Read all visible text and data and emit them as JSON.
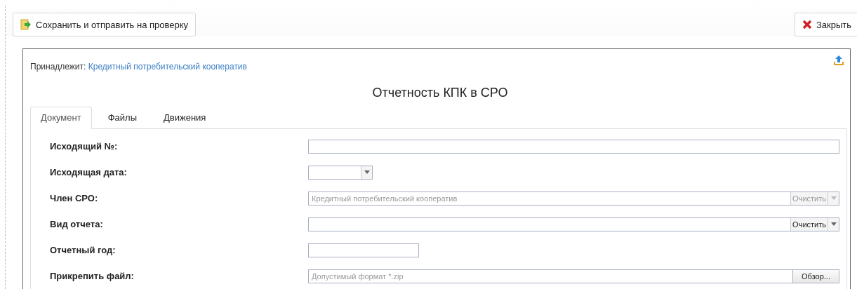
{
  "toolbar": {
    "save_button": "Сохранить и отправить на проверку",
    "close_button": "Закрыть"
  },
  "panel": {
    "owner_label": "Принадлежит:",
    "owner_link": "Кредитный потребительский кооператив",
    "title": "Отчетность КПК в СРО",
    "tabs": [
      {
        "label": "Документ",
        "selected": true
      },
      {
        "label": "Файлы",
        "selected": false
      },
      {
        "label": "Движения",
        "selected": false
      }
    ],
    "fields": [
      {
        "kind": "text",
        "label": "Исходящий №:"
      },
      {
        "kind": "date",
        "label": "Исходящая дата:"
      },
      {
        "kind": "combo",
        "label": "Член СРО:",
        "placeholder": "Кредитный потребительский кооператив",
        "clear_label": "Очистить",
        "disabled": true
      },
      {
        "kind": "combo",
        "label": "Вид отчета:",
        "clear_label": "Очистить",
        "disabled": false
      },
      {
        "kind": "short_text",
        "label": "Отчетный год:"
      },
      {
        "kind": "file",
        "label": "Прикрепить файл:",
        "placeholder": "Допустимый формат *.zip",
        "browse_label": "Обзор..."
      }
    ]
  }
}
